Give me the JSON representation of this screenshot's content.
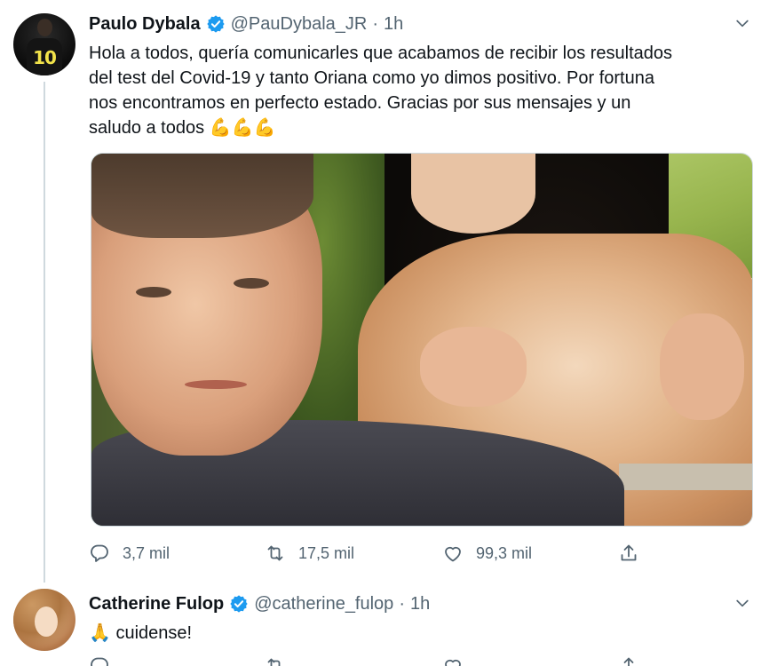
{
  "tweets": [
    {
      "name": "Paulo Dybala",
      "handle": "@PauDybala_JR",
      "separator": "·",
      "time": "1h",
      "text_lines": [
        "Hola a todos, quería comunicarles que acabamos de recibir los resultados",
        "del test del Covid-19 y tanto Oriana como yo dimos positivo. Por fortuna",
        "nos encontramos en perfecto estado. Gracias por sus mensajes y un",
        "saludo a todos 💪💪💪"
      ],
      "actions": {
        "replies": "3,7 mil",
        "retweets": "17,5 mil",
        "likes": "99,3 mil"
      }
    },
    {
      "name": "Catherine Fulop",
      "handle": "@catherine_fulop",
      "separator": "·",
      "time": "1h",
      "text": "🙏 cuidense!"
    }
  ],
  "colors": {
    "verified": "#1d9bf0",
    "secondary_text": "#536471",
    "thread_line": "#cfd9de"
  },
  "icons": [
    "verified-badge-icon",
    "chevron-down-icon",
    "reply-icon",
    "retweet-icon",
    "like-icon",
    "share-icon"
  ]
}
